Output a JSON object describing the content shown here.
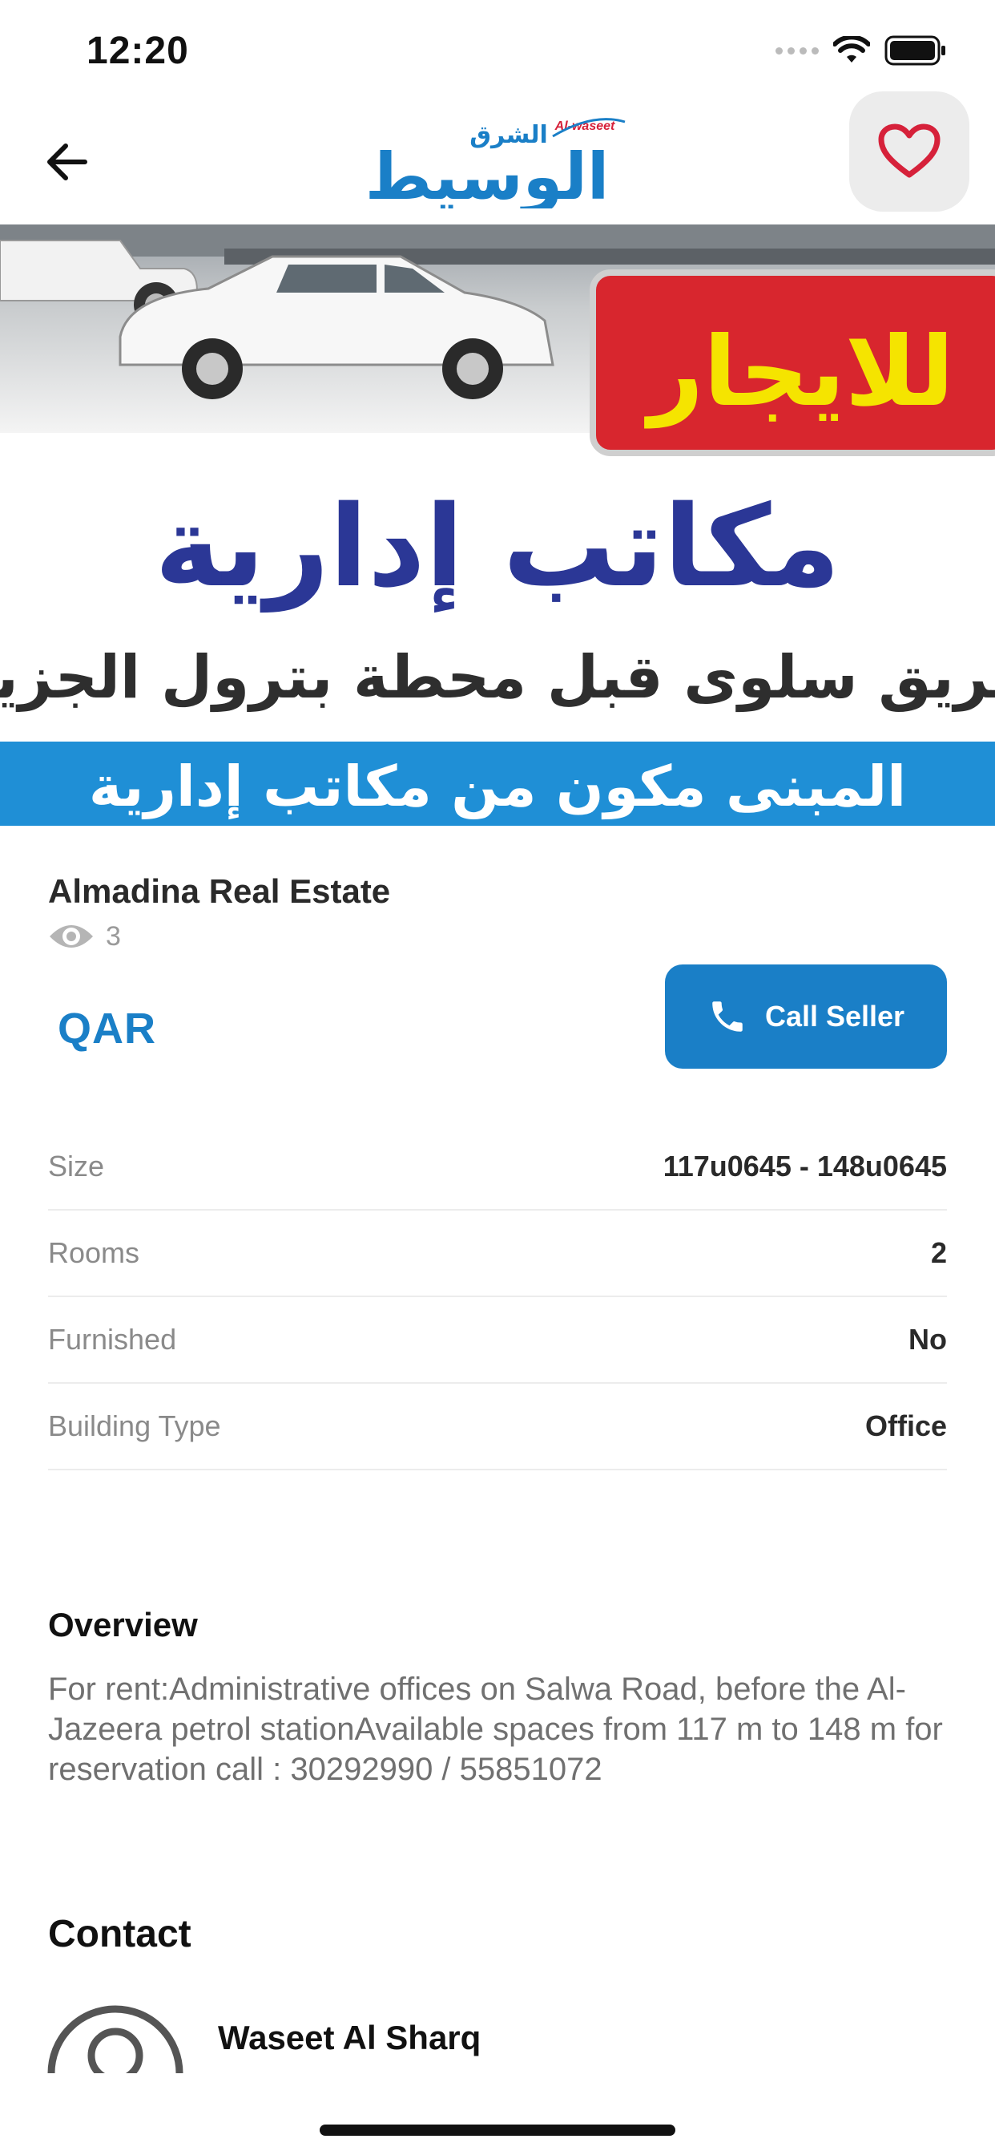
{
  "status_bar": {
    "time": "12:20"
  },
  "nav": {
    "logo": {
      "arabic_top": "الشرق",
      "arabic_main": "الوسيط",
      "latin": "Al-waseet"
    }
  },
  "hero": {
    "banner_red": "للايجار",
    "headline": "مكاتب إدارية",
    "subline": "بطريق سلوى قبل محطة بترول الجزيرة",
    "footer": "المبنى مكون من مكاتب إدارية"
  },
  "listing": {
    "seller_name": "Almadina Real Estate",
    "views": "3",
    "price_currency": "QAR",
    "call_label": "Call Seller"
  },
  "specs": [
    {
      "label": "Size",
      "value": "117u0645 - 148u0645"
    },
    {
      "label": "Rooms",
      "value": "2"
    },
    {
      "label": "Furnished",
      "value": "No"
    },
    {
      "label": "Building Type",
      "value": "Office"
    }
  ],
  "overview": {
    "title": "Overview",
    "text": "For rent:Administrative offices on Salwa Road, before the Al-Jazeera petrol stationAvailable spaces from 117 m to 148 m for reservation call :  30292990  /  55851072"
  },
  "contact": {
    "title": "Contact",
    "name": "Waseet Al Sharq"
  },
  "colors": {
    "accent": "#1a7fc7",
    "favorite_heart": "#d6213a",
    "banner_red": "#d8262e",
    "banner_yellow": "#f5e400",
    "headline_blue": "#2b3796",
    "footer_blue": "#1f8fd6"
  },
  "icons": [
    "back-arrow-icon",
    "heart-icon",
    "eye-icon",
    "phone-icon",
    "avatar-icon",
    "wifi-icon",
    "battery-icon"
  ]
}
